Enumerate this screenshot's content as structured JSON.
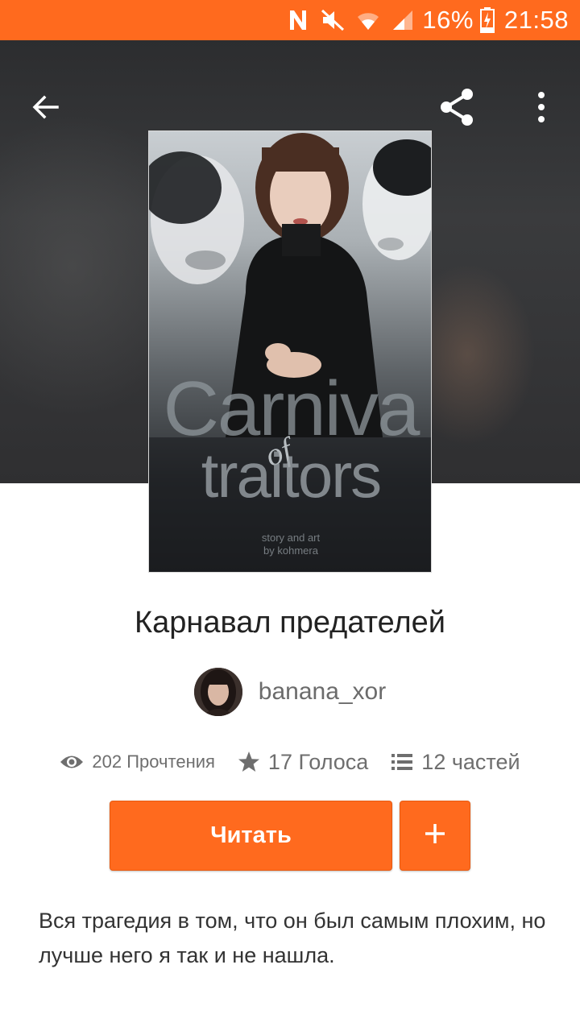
{
  "status_bar": {
    "battery": "16%",
    "time": "21:58",
    "icons": [
      "nfc-icon",
      "mute-icon",
      "wifi-icon",
      "signal-icon",
      "battery-charging-icon"
    ]
  },
  "toolbar": {
    "icons": [
      "back-arrow-icon",
      "share-icon",
      "more-vertical-icon"
    ]
  },
  "book": {
    "cover_title_line1": "Carniva",
    "cover_title_of": "of",
    "cover_title_line2": "traitors",
    "cover_subtitle_line1": "story and art",
    "cover_subtitle_line2": "by kohmera",
    "title": "Карнавал предателей",
    "author": "banana_xor",
    "stats": {
      "reads": "202 Прочтения",
      "votes": "17 Голоса",
      "parts": "12 частей"
    },
    "read_label": "Читать",
    "add_icon": "plus-icon",
    "description": "Вся трагедия в том, что он был самым плохим, но лучше него я так и не нашла."
  },
  "colors": {
    "accent": "#ff6a1e",
    "hero_bg": "#333436",
    "text_dark": "#222222",
    "text_muted": "#6b6b6b"
  }
}
